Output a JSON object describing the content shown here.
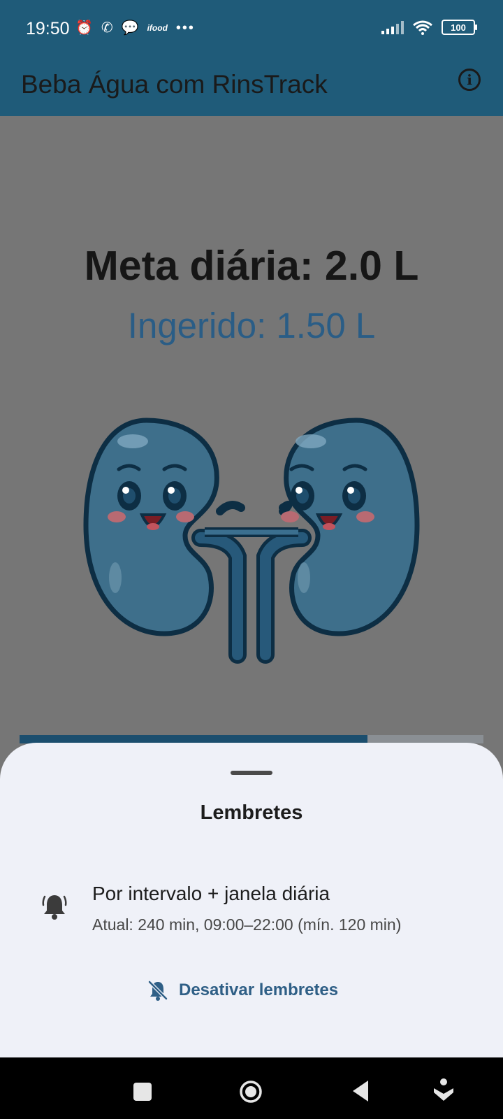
{
  "status_bar": {
    "time": "19:50",
    "left_icons": [
      "alarm-icon",
      "whatsapp-icon",
      "chat-bubble-icon"
    ],
    "ifood_label": "ifood",
    "more_dots": "•••",
    "battery": "100"
  },
  "app_bar": {
    "title": "Beba Água com RinsTrack",
    "info_icon_glyph": "i"
  },
  "main": {
    "goal_text": "Meta diária: 2.0 L",
    "intake_text": "Ingerido: 1.50 L",
    "progress_fraction": 0.75,
    "illustration": "kidneys-mascot",
    "colors": {
      "scrim": "#767676",
      "progress_fill": "#1b4e6e",
      "progress_track": "#8a8f94",
      "accent": "#1f5b79"
    }
  },
  "sheet": {
    "title": "Lembretes",
    "option_title": "Por intervalo + janela diária",
    "option_subtitle": "Atual: 240 min, 09:00–22:00 (mín. 120 min)",
    "disable_label": "Desativar lembretes"
  },
  "nav_bar": {
    "buttons": [
      "recents-icon",
      "home-icon",
      "back-icon",
      "assist-icon"
    ]
  }
}
